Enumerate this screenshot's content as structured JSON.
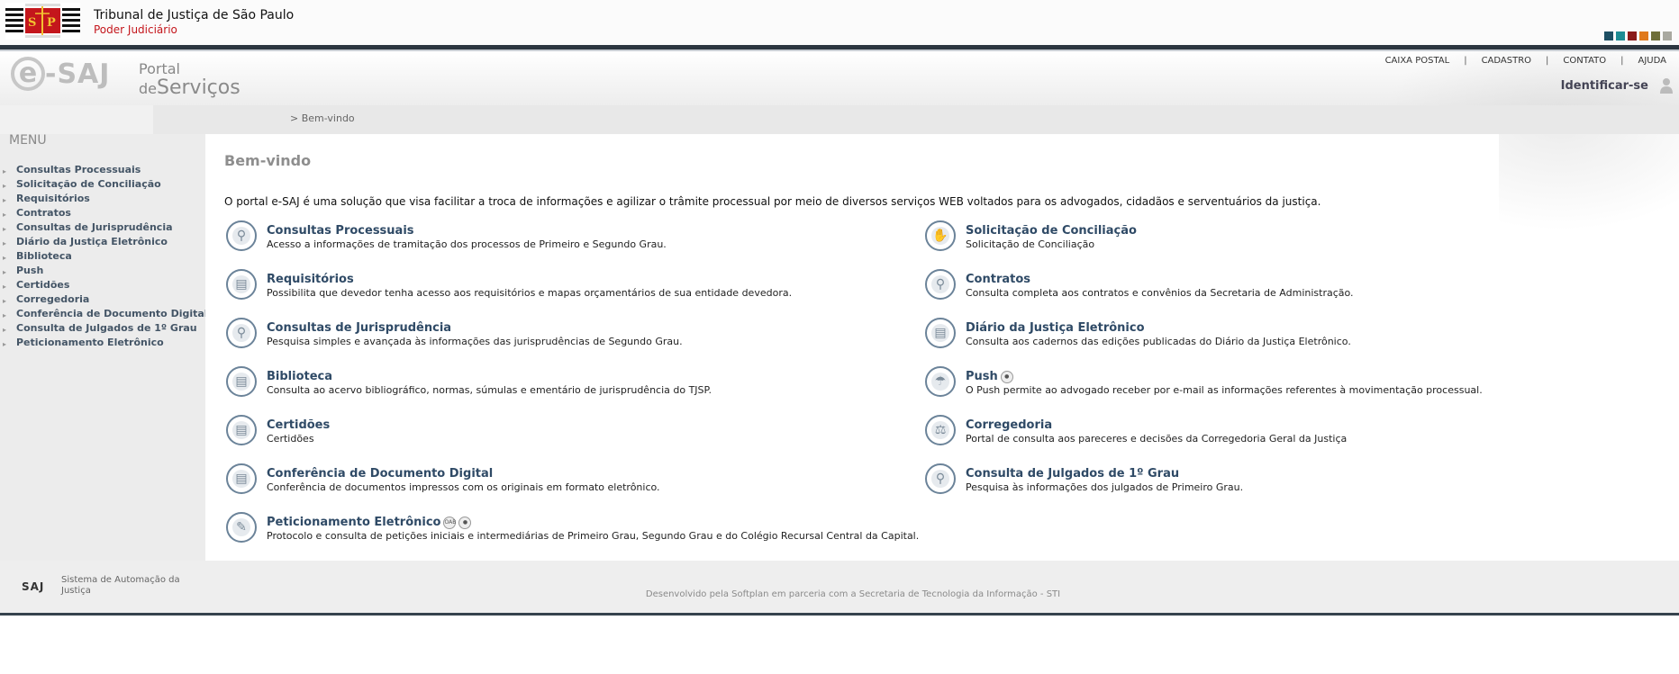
{
  "header": {
    "title": "Tribunal de Justiça de São Paulo",
    "subtitle": "Poder Judiciário",
    "color_swatches": [
      "#1d4f63",
      "#1d8c94",
      "#8b1a1a",
      "#e07a1c",
      "#6f6f3a",
      "#a9a9a0"
    ]
  },
  "portal": {
    "logo_saj": "-SAJ",
    "logo_e": "e",
    "logo_portal": "Portal",
    "logo_de": "de",
    "logo_servicos": "Serviços",
    "links": [
      "CAIXA POSTAL",
      "CADASTRO",
      "CONTATO",
      "AJUDA"
    ],
    "identify": "Identificar-se"
  },
  "breadcrumb": "> Bem-vindo",
  "menu": {
    "title": "MENU",
    "items": [
      "Consultas Processuais",
      "Solicitação de Conciliação",
      "Requisitórios",
      "Contratos",
      "Consultas de Jurisprudência",
      "Diário da Justiça Eletrônico",
      "Biblioteca",
      "Push",
      "Certidões",
      "Corregedoria",
      "Conferência de Documento Digital",
      "Consulta de Julgados de 1º Grau",
      "Peticionamento Eletrônico"
    ]
  },
  "main": {
    "title": "Bem-vindo",
    "intro": "O portal e-SAJ é uma solução que visa facilitar a troca de informações e agilizar o trâmite processual por meio de diversos serviços WEB voltados para os advogados, cidadãos e serventuários da justiça.",
    "services": [
      {
        "title": "Consultas Processuais",
        "desc": "Acesso a informações de tramitação dos processos de Primeiro e Segundo Grau.",
        "icon": "search-document-icon"
      },
      {
        "title": "Solicitação de Conciliação",
        "desc": "Solicitação de Conciliação",
        "icon": "handshake-icon"
      },
      {
        "title": "Requisitórios",
        "desc": "Possibilita que devedor tenha acesso aos requisitórios e mapas orçamentários de sua entidade devedora.",
        "icon": "document-icon"
      },
      {
        "title": "Contratos",
        "desc": "Consulta completa aos contratos e convênios da Secretaria de Administração.",
        "icon": "contract-icon"
      },
      {
        "title": "Consultas de Jurisprudência",
        "desc": "Pesquisa simples e avançada às informações das jurisprudências de Segundo Grau.",
        "icon": "search-book-icon"
      },
      {
        "title": "Diário da Justiça Eletrônico",
        "desc": "Consulta aos cadernos das edições publicadas do Diário da Justiça Eletrônico.",
        "icon": "open-book-icon"
      },
      {
        "title": "Biblioteca",
        "desc": "Consulta ao acervo bibliográfico, normas, súmulas e ementário de jurisprudência do TJSP.",
        "icon": "library-book-icon"
      },
      {
        "title": "Push",
        "desc": "O Push permite ao advogado receber por e-mail as informações referentes à movimentação processual.",
        "icon": "parachute-icon"
      },
      {
        "title": "Certidões",
        "desc": "Certidões",
        "icon": "certificate-icon"
      },
      {
        "title": "Corregedoria",
        "desc": "Portal de consulta aos pareceres e decisões da Corregedoria Geral da Justiça",
        "icon": "scales-icon"
      },
      {
        "title": "Conferência de Documento Digital",
        "desc": "Conferência de documentos impressos com os originais em formato eletrônico.",
        "icon": "documents-stack-icon"
      },
      {
        "title": "Consulta de Julgados de 1º Grau",
        "desc": "Pesquisa às informações dos julgados de Primeiro Grau.",
        "icon": "search-gavel-icon"
      },
      {
        "title": "Peticionamento Eletrônico",
        "desc": "Protocolo e consulta de petições iniciais e intermediárias de Primeiro Grau, Segundo Grau e do Colégio Recursal Central da Capital.",
        "icon": "signature-document-icon"
      }
    ],
    "push_badge": "user-lock-icon",
    "petic_badges": [
      "oab-icon",
      "lock-icon"
    ],
    "oab_label": "OAB"
  },
  "footer": {
    "saj": "SAJ",
    "system": "Sistema de Automação da Justiça",
    "developed": "Desenvolvido pela Softplan em parceria com a Secretaria de Tecnologia da Informação - STI"
  }
}
